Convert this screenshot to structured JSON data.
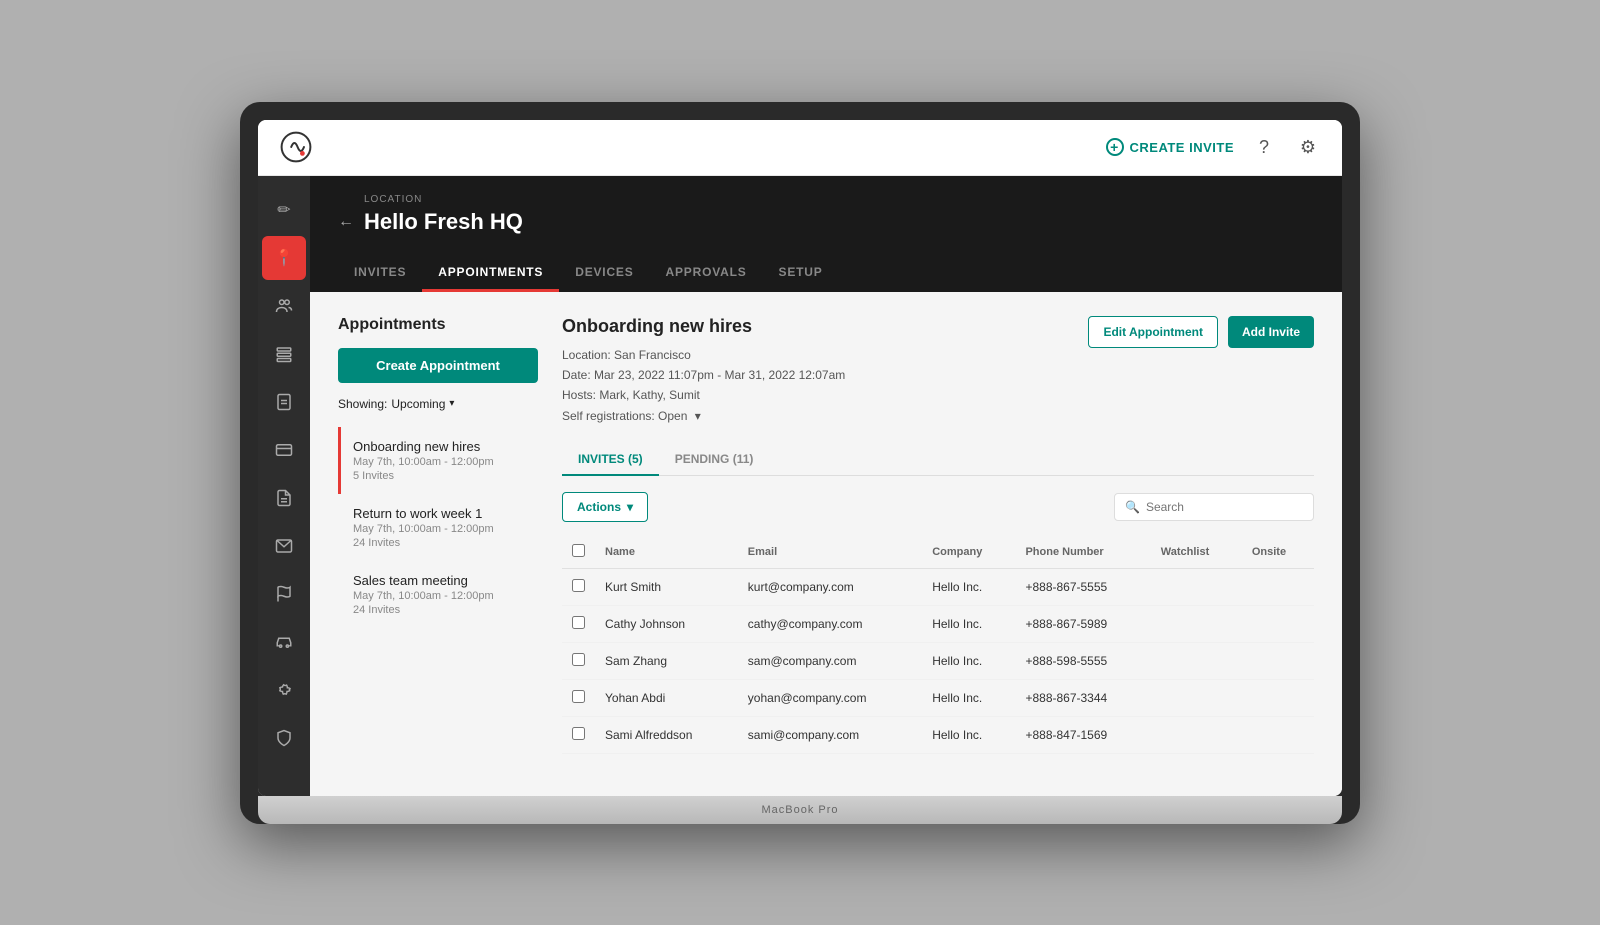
{
  "laptop": {
    "model_label": "MacBook Pro"
  },
  "topbar": {
    "create_invite_label": "CREATE INVITE",
    "help_icon": "?",
    "settings_icon": "⚙"
  },
  "sidebar": {
    "items": [
      {
        "id": "edit",
        "icon": "✏",
        "active": false
      },
      {
        "id": "location",
        "icon": "📍",
        "active": true
      },
      {
        "id": "people",
        "icon": "👥",
        "active": false
      },
      {
        "id": "layers",
        "icon": "▤",
        "active": false
      },
      {
        "id": "tools",
        "icon": "🔧",
        "active": false
      },
      {
        "id": "card",
        "icon": "🪪",
        "active": false
      },
      {
        "id": "document",
        "icon": "📄",
        "active": false
      },
      {
        "id": "mail",
        "icon": "✉",
        "active": false
      },
      {
        "id": "flag",
        "icon": "⚑",
        "active": false
      },
      {
        "id": "car",
        "icon": "🚗",
        "active": false
      },
      {
        "id": "puzzle",
        "icon": "🧩",
        "active": false
      },
      {
        "id": "shield",
        "icon": "🛡",
        "active": false
      }
    ]
  },
  "location": {
    "back_icon": "←",
    "label": "LOCATION",
    "title": "Hello Fresh HQ"
  },
  "nav_tabs": [
    {
      "id": "invites",
      "label": "INVITES",
      "active": false
    },
    {
      "id": "appointments",
      "label": "APPOINTMENTS",
      "active": true
    },
    {
      "id": "devices",
      "label": "DEVICES",
      "active": false
    },
    {
      "id": "approvals",
      "label": "APPROVALS",
      "active": false
    },
    {
      "id": "setup",
      "label": "SETUP",
      "active": false
    }
  ],
  "appointments_panel": {
    "title": "Appointments",
    "create_btn_label": "Create Appointment",
    "showing_label": "Showing:",
    "filter_value": "Upcoming",
    "filter_icon": "▾",
    "items": [
      {
        "name": "Onboarding new hires",
        "time": "May 7th, 10:00am - 12:00pm",
        "invites": "5 Invites",
        "selected": true
      },
      {
        "name": "Return to work week 1",
        "time": "May 7th, 10:00am - 12:00pm",
        "invites": "24 Invites",
        "selected": false
      },
      {
        "name": "Sales team meeting",
        "time": "May 7th, 10:00am - 12:00pm",
        "invites": "24 Invites",
        "selected": false
      }
    ]
  },
  "detail": {
    "title": "Onboarding new hires",
    "location": "Location: San Francisco",
    "date": "Date: Mar 23, 2022 11:07pm - Mar 31, 2022 12:07am",
    "hosts": "Hosts: Mark, Kathy, Sumit",
    "self_reg": "Self registrations: Open",
    "self_reg_icon": "▾",
    "edit_btn_label": "Edit Appointment",
    "add_invite_btn_label": "Add Invite"
  },
  "sub_tabs": [
    {
      "id": "invites",
      "label": "INVITES (5)",
      "active": true
    },
    {
      "id": "pending",
      "label": "PENDING (11)",
      "active": false
    }
  ],
  "toolbar": {
    "actions_label": "Actions",
    "actions_icon": "▾",
    "search_placeholder": "Search"
  },
  "table": {
    "columns": [
      {
        "id": "checkbox",
        "label": ""
      },
      {
        "id": "name",
        "label": "Name"
      },
      {
        "id": "email",
        "label": "Email"
      },
      {
        "id": "company",
        "label": "Company"
      },
      {
        "id": "phone",
        "label": "Phone Number"
      },
      {
        "id": "watchlist",
        "label": "Watchlist"
      },
      {
        "id": "onsite",
        "label": "Onsite"
      }
    ],
    "rows": [
      {
        "name": "Kurt Smith",
        "email": "kurt@company.com",
        "company": "Hello Inc.",
        "phone": "+888-867-5555",
        "watchlist": "",
        "onsite": ""
      },
      {
        "name": "Cathy Johnson",
        "email": "cathy@company.com",
        "company": "Hello Inc.",
        "phone": "+888-867-5989",
        "watchlist": "",
        "onsite": ""
      },
      {
        "name": "Sam Zhang",
        "email": "sam@company.com",
        "company": "Hello Inc.",
        "phone": "+888-598-5555",
        "watchlist": "",
        "onsite": ""
      },
      {
        "name": "Yohan Abdi",
        "email": "yohan@company.com",
        "company": "Hello Inc.",
        "phone": "+888-867-3344",
        "watchlist": "",
        "onsite": ""
      },
      {
        "name": "Sami Alfreddson",
        "email": "sami@company.com",
        "company": "Hello Inc.",
        "phone": "+888-847-1569",
        "watchlist": "",
        "onsite": ""
      }
    ]
  }
}
